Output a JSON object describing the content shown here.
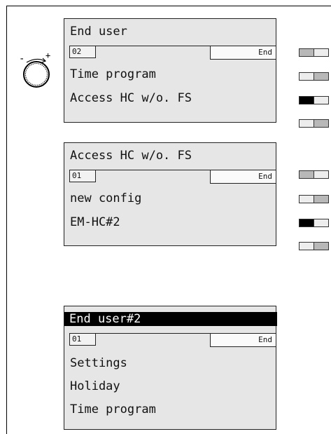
{
  "panel1": {
    "title": "End user",
    "number": "02",
    "end_label": "End",
    "lines": [
      "Time program",
      "Access HC w/o. FS"
    ]
  },
  "panel2": {
    "title": "Access HC w/o. FS",
    "number": "01",
    "end_label": "End",
    "lines": [
      "new config",
      "EM-HC#2"
    ]
  },
  "panel3": {
    "title": "End user#2",
    "number": "01",
    "end_label": "End",
    "lines": [
      "Settings",
      "Holiday",
      "Time program"
    ]
  },
  "knob": {
    "minus": "-",
    "plus": "+"
  },
  "switches": {
    "group1": [
      "left",
      "right",
      "on",
      "right"
    ],
    "group2": [
      "left",
      "right",
      "on",
      "right"
    ]
  },
  "colors": {
    "panel_bg": "#e6e6e6",
    "highlight": "#000000",
    "text": "#111111"
  },
  "icons": [
    "rotary-knob-icon",
    "selector-switch-icon"
  ]
}
